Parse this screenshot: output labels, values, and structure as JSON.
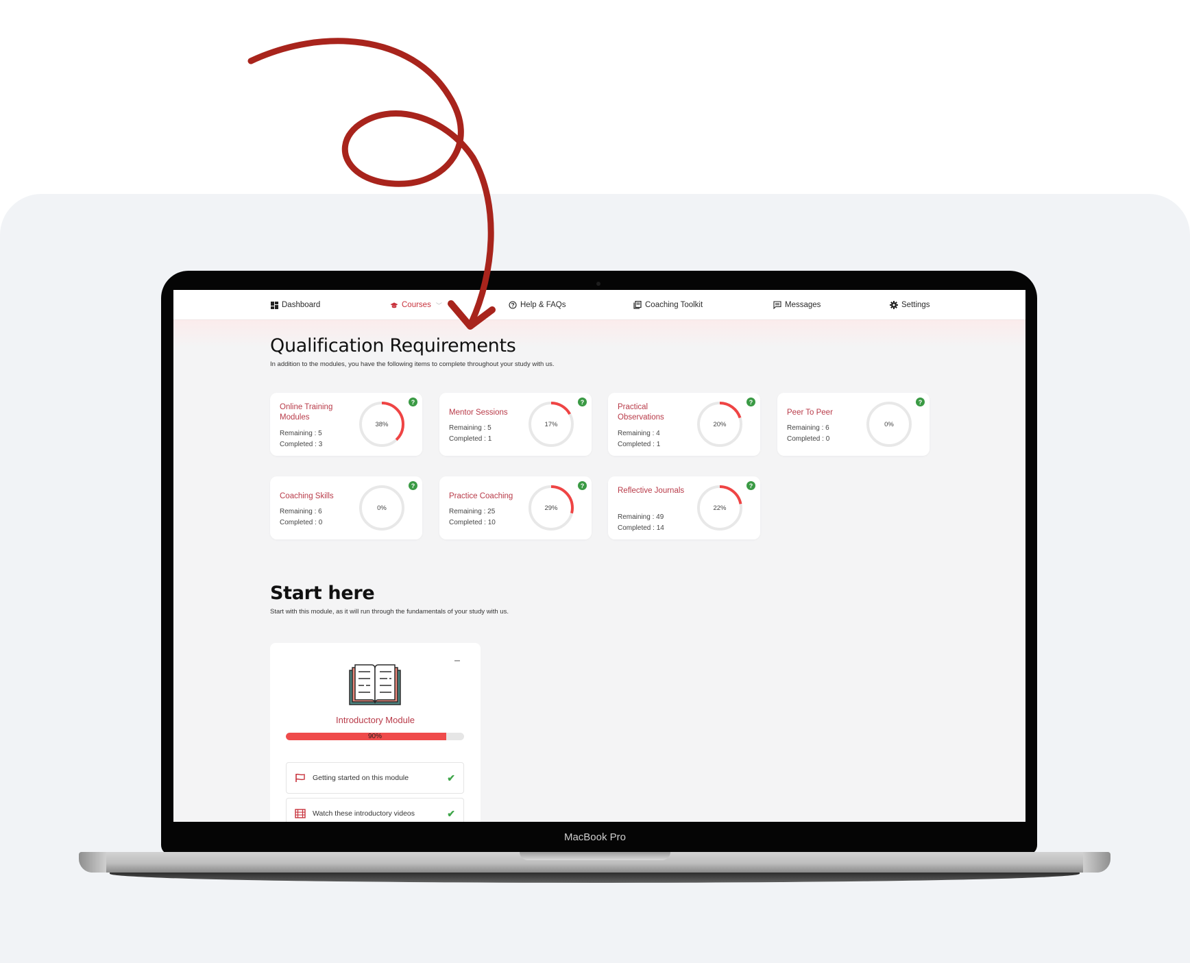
{
  "device": {
    "label": "MacBook Pro"
  },
  "nav": {
    "items": [
      {
        "label": "Dashboard",
        "icon": "dashboard-icon",
        "active": false
      },
      {
        "label": "Courses",
        "icon": "graduation-cap-icon",
        "active": true,
        "dropdown": true
      },
      {
        "label": "Help & FAQs",
        "icon": "question-circle-icon",
        "active": false
      },
      {
        "label": "Coaching Toolkit",
        "icon": "book-stack-icon",
        "active": false
      },
      {
        "label": "Messages",
        "icon": "message-icon",
        "active": false
      },
      {
        "label": "Settings",
        "icon": "gear-icon",
        "active": false
      }
    ]
  },
  "qualification": {
    "title": "Qualification Requirements",
    "subtitle": "In addition to the modules, you have the following items to complete throughout your study with us.",
    "cards": [
      {
        "title": "Online Training Modules",
        "remaining": "Remaining : 5",
        "completed": "Completed : 3",
        "percent_label": "38%",
        "percent": 38
      },
      {
        "title": "Mentor Sessions",
        "remaining": "Remaining : 5",
        "completed": "Completed : 1",
        "percent_label": "17%",
        "percent": 17
      },
      {
        "title": "Practical Observations",
        "remaining": "Remaining : 4",
        "completed": "Completed : 1",
        "percent_label": "20%",
        "percent": 20
      },
      {
        "title": "Peer To Peer",
        "remaining": "Remaining : 6",
        "completed": "Completed : 0",
        "percent_label": "0%",
        "percent": 0
      },
      {
        "title": "Coaching Skills",
        "remaining": "Remaining : 6",
        "completed": "Completed : 0",
        "percent_label": "0%",
        "percent": 0
      },
      {
        "title": "Practice Coaching",
        "remaining": "Remaining : 25",
        "completed": "Completed : 10",
        "percent_label": "29%",
        "percent": 29
      },
      {
        "title": "Reflective Journals",
        "remaining": "Remaining : 49",
        "completed": "Completed : 14",
        "percent_label": "22%",
        "percent": 22
      }
    ],
    "help_glyph": "?"
  },
  "start_here": {
    "title": "Start here",
    "subtitle": "Start with this module, as it will run through the fundamentals of your study with us.",
    "module": {
      "title": "Introductory Module",
      "progress_label": "90%",
      "progress": 90,
      "tasks": [
        {
          "label": "Getting started on this module",
          "icon": "flag-icon",
          "done": true
        },
        {
          "label": "Watch these introductory videos",
          "icon": "film-icon",
          "done": true
        }
      ]
    }
  },
  "colors": {
    "accent": "#c8323c",
    "ring_fill": "#ef4444",
    "ring_track": "#e8e8e8",
    "success": "#3a9a44",
    "arrow": "#a8241c"
  },
  "check_glyph": "✔"
}
